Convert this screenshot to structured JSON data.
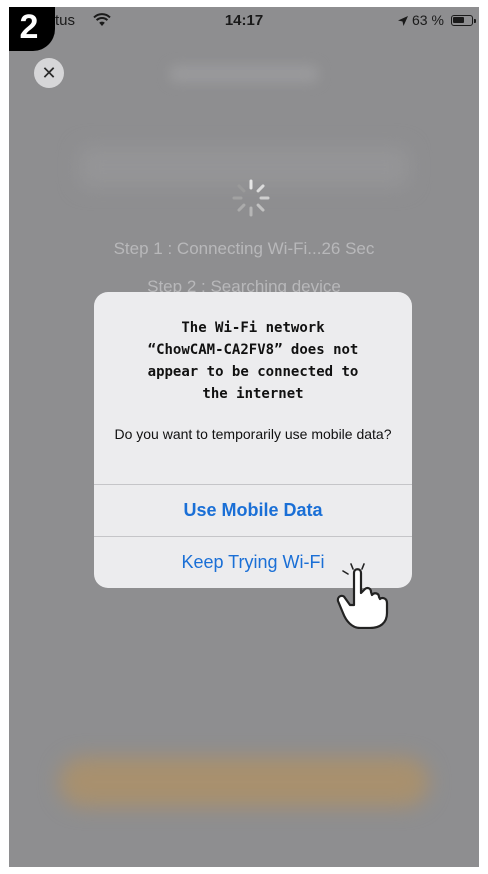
{
  "step_badge": "2",
  "status_bar": {
    "carrier": "Optus",
    "time": "14:17",
    "battery": "63 %",
    "icons": [
      "wifi-icon",
      "location-icon",
      "battery-icon"
    ]
  },
  "close_button": {
    "icon": "close-icon",
    "glyph": "✕"
  },
  "progress": {
    "step1": "Step 1 : Connecting Wi-Fi...26 Sec",
    "step2": "Step 2 : Searching device"
  },
  "alert": {
    "title": "The Wi-Fi network\n“ChowCAM-CA2FV8” does not\nappear to be connected to\nthe internet",
    "message": "Do you want to temporarily use mobile data?",
    "buttons": {
      "primary": "Use Mobile Data",
      "secondary": "Keep Trying Wi-Fi"
    }
  },
  "colors": {
    "button_text": "#1a6fd6",
    "backdrop": "#8e8e90",
    "dialog_bg": "#ececee"
  }
}
